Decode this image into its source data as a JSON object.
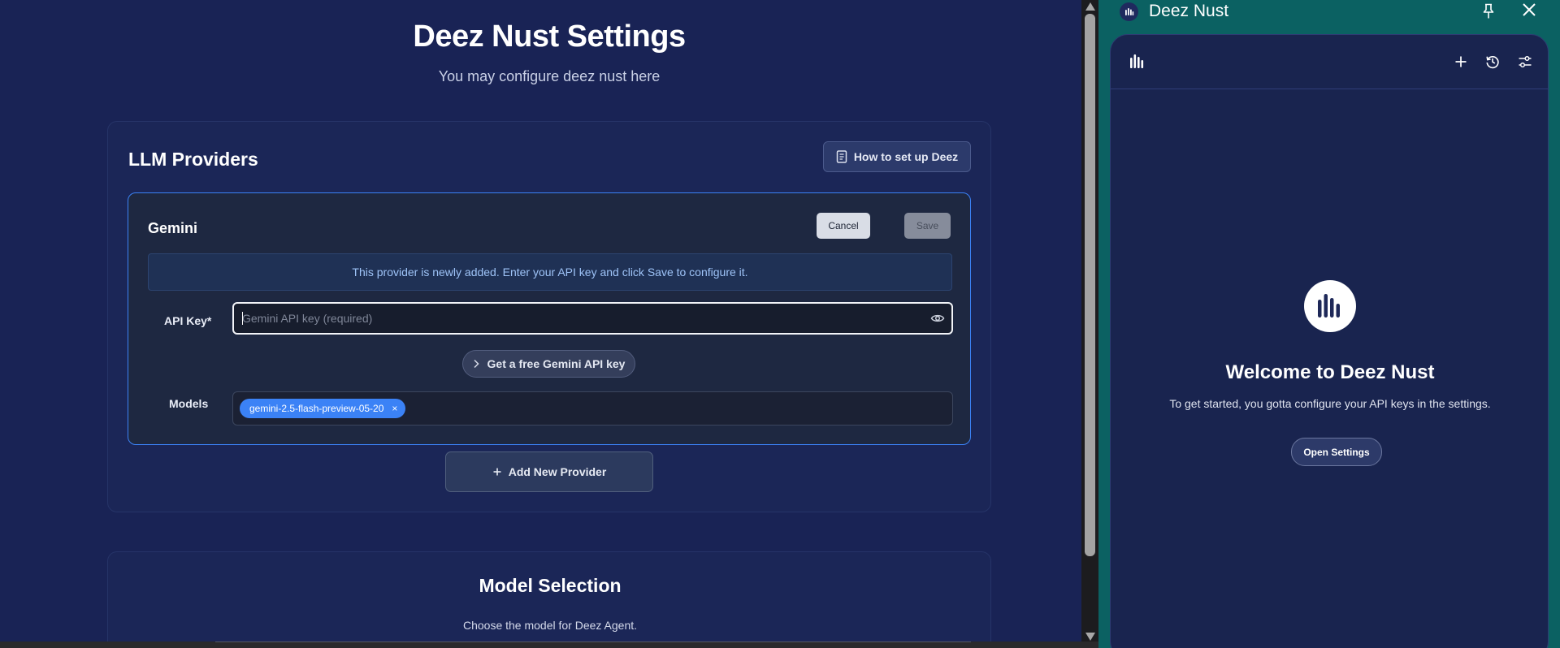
{
  "settings": {
    "title": "Deez Nust Settings",
    "subtitle": "You may configure deez nust here",
    "llm_providers": {
      "title": "LLM Providers",
      "howto_label": "How to set up Deez",
      "provider": {
        "name": "Gemini",
        "cancel_label": "Cancel",
        "save_label": "Save",
        "notice": "This provider is newly added. Enter your API key and click Save to configure it.",
        "api_key_label": "API Key*",
        "api_key_value": "",
        "api_key_placeholder": "Gemini API key (required)",
        "free_key_label": "Get a free Gemini API key",
        "models_label": "Models",
        "models": [
          "gemini-2.5-flash-preview-05-20"
        ]
      },
      "add_provider_label": "Add New Provider"
    },
    "model_selection": {
      "title": "Model Selection",
      "subtitle": "Choose the model for Deez Agent."
    }
  },
  "side_panel": {
    "title": "Deez Nust",
    "welcome_title": "Welcome to Deez Nust",
    "welcome_text": "To get started, you gotta configure your API keys in the settings.",
    "open_settings_label": "Open Settings"
  },
  "icons": {
    "howto": "document-icon",
    "eye": "eye-icon",
    "free_key": "chevron-right-icon",
    "chip_remove": "close-icon",
    "add": "plus-icon",
    "pin": "pin-icon",
    "close": "close-icon",
    "new_chat": "plus-icon",
    "history": "history-icon",
    "settings": "sliders-icon",
    "logo": "deez-logo-icon"
  },
  "colors": {
    "page_bg": "#192355",
    "card_bg": "#1b2657",
    "provider_bg": "#1e2841",
    "accent": "#3b82f6",
    "panel_bg": "#0b6162",
    "notice_text": "#9ec3f7"
  }
}
